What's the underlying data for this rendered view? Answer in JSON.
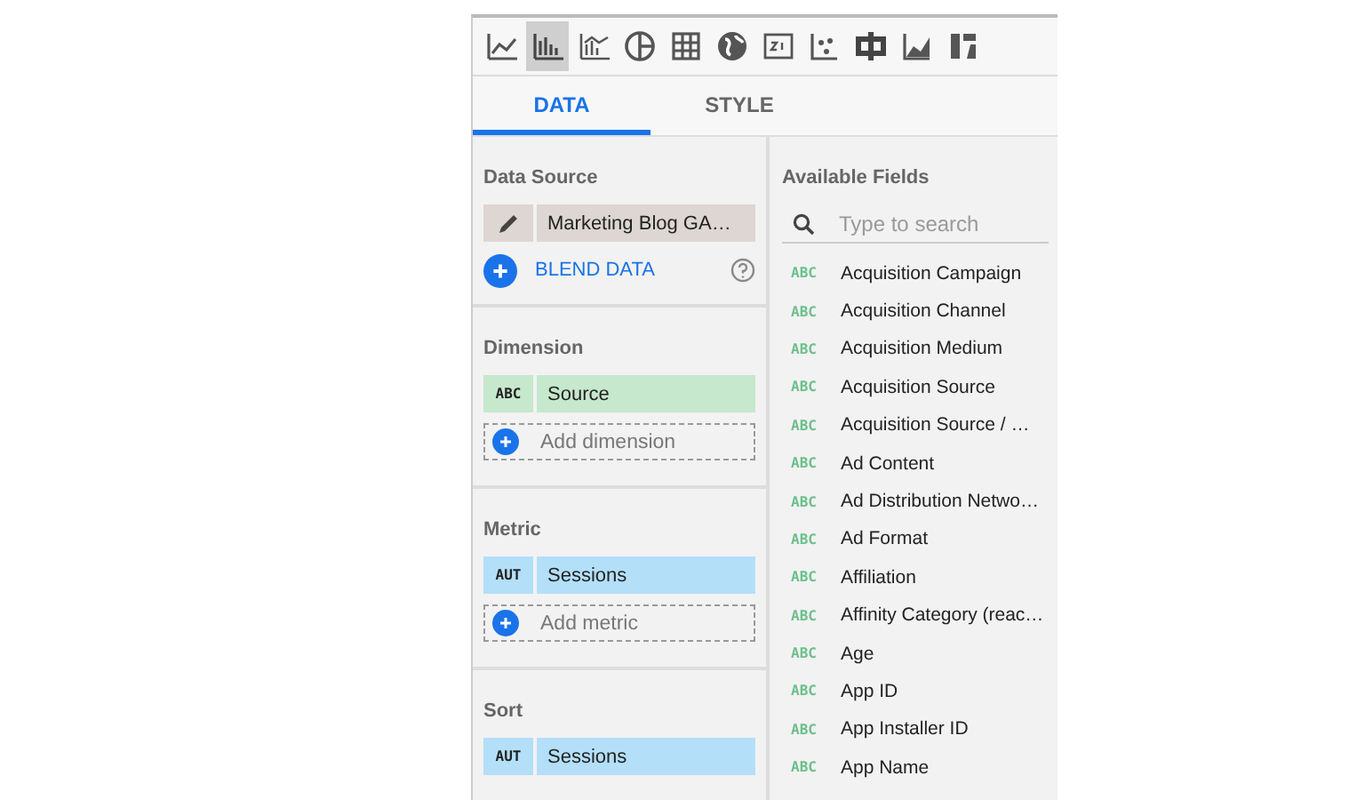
{
  "chart_types": [
    {
      "selected": false
    },
    {
      "selected": true
    },
    {
      "selected": false
    },
    {
      "selected": false
    },
    {
      "selected": false
    },
    {
      "selected": false
    },
    {
      "selected": false
    },
    {
      "selected": false
    },
    {
      "selected": false
    },
    {
      "selected": false
    },
    {
      "selected": false
    }
  ],
  "tabs": [
    {
      "label": "DATA",
      "selected": true
    },
    {
      "label": "STYLE",
      "selected": false
    }
  ],
  "data_source": {
    "title": "Data Source",
    "name": "Marketing Blog GA…",
    "blend_label": "BLEND DATA"
  },
  "sections": [
    {
      "kind": "dimension",
      "title": "Dimension",
      "fields": [
        {
          "type": "ABC",
          "name": "Source"
        }
      ],
      "add_label": "Add dimension"
    },
    {
      "kind": "metric",
      "title": "Metric",
      "fields": [
        {
          "type": "AUT",
          "name": "Sessions"
        }
      ],
      "add_label": "Add metric"
    },
    {
      "kind": "metric",
      "title": "Sort",
      "fields": [
        {
          "type": "AUT",
          "name": "Sessions"
        }
      ]
    }
  ],
  "available_fields": {
    "title": "Available Fields",
    "search": {
      "placeholder": "Type to search"
    },
    "fields": [
      {
        "type": "ABC",
        "name": "Acquisition Campaign"
      },
      {
        "type": "ABC",
        "name": "Acquisition Channel"
      },
      {
        "type": "ABC",
        "name": "Acquisition Medium"
      },
      {
        "type": "ABC",
        "name": "Acquisition Source"
      },
      {
        "type": "ABC",
        "name": "Acquisition Source / …"
      },
      {
        "type": "ABC",
        "name": "Ad Content"
      },
      {
        "type": "ABC",
        "name": "Ad Distribution Netwo…"
      },
      {
        "type": "ABC",
        "name": "Ad Format"
      },
      {
        "type": "ABC",
        "name": "Affiliation"
      },
      {
        "type": "ABC",
        "name": "Affinity Category (reac…"
      },
      {
        "type": "ABC",
        "name": "Age"
      },
      {
        "type": "ABC",
        "name": "App ID"
      },
      {
        "type": "ABC",
        "name": "App Installer ID"
      },
      {
        "type": "ABC",
        "name": "App Name"
      }
    ]
  }
}
